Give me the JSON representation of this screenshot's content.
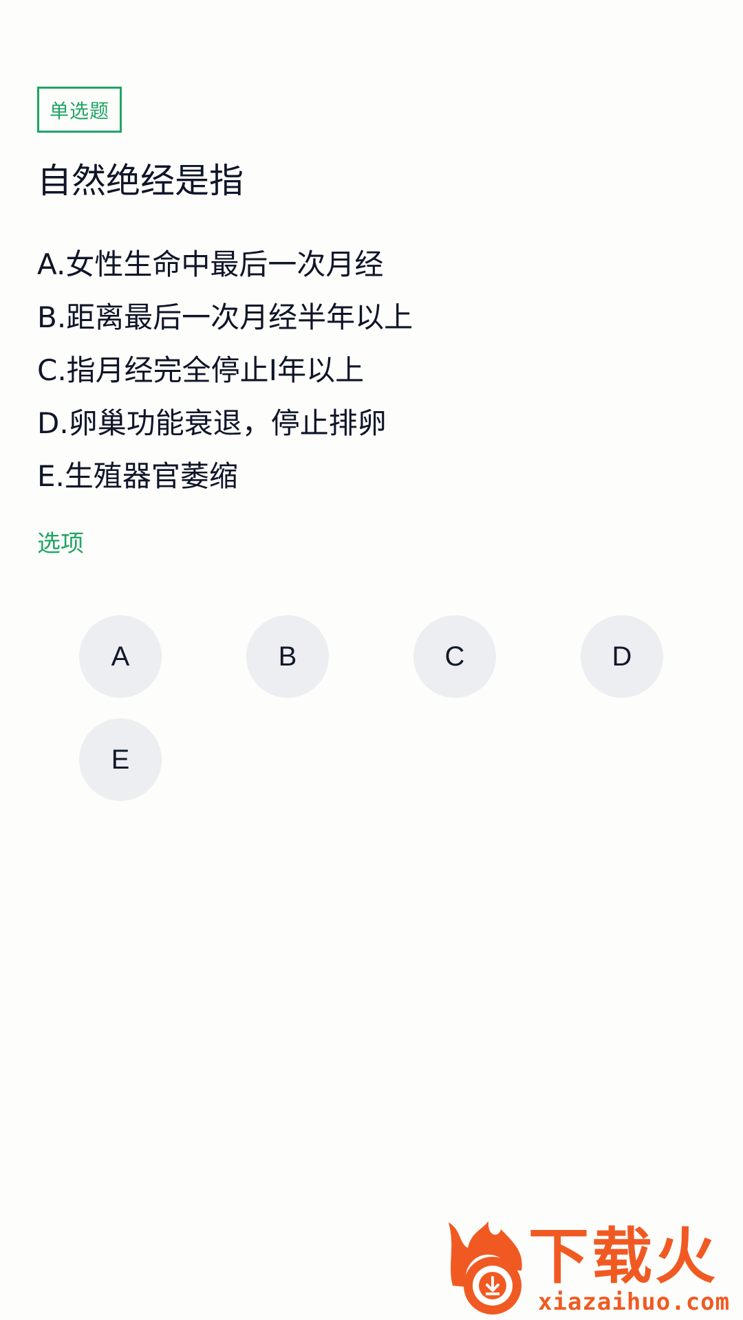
{
  "question": {
    "type_label": "单选题",
    "title": "自然绝经是指",
    "options": [
      "A.女性生命中最后一次月经",
      "B.距离最后一次月经半年以上",
      "C.指月经完全停止I年以上",
      "D.卵巢功能衰退，停止排卵",
      "E.生殖器官萎缩"
    ]
  },
  "answer_section": {
    "label": "选项",
    "choices": [
      "A",
      "B",
      "C",
      "D",
      "E"
    ]
  },
  "watermark": {
    "brand": "下载火",
    "domain": "xiazaihuo.com",
    "icon": "flame-download-icon",
    "color": "#f05a22"
  },
  "colors": {
    "accent": "#20a464",
    "choice_bg": "#eceef1",
    "text": "#0f1528"
  }
}
